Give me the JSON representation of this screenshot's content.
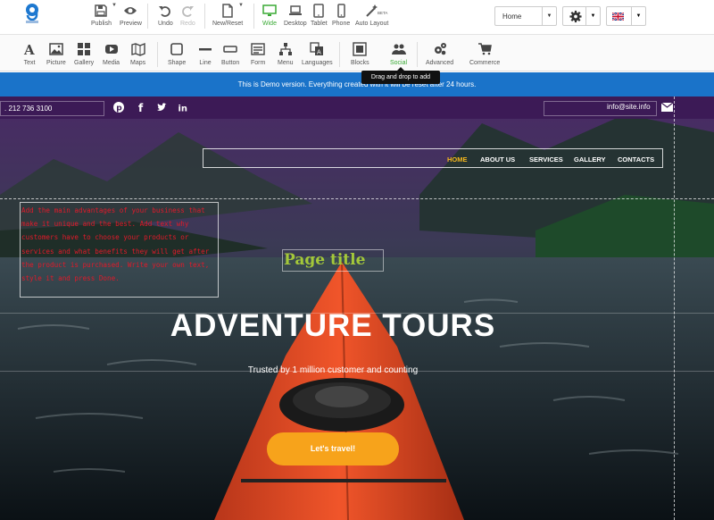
{
  "toolbar": {
    "publish": "Publish",
    "preview": "Preview",
    "undo": "Undo",
    "redo": "Redo",
    "new_reset": "New/Reset",
    "wide": "Wide",
    "desktop": "Desktop",
    "tablet": "Tablet",
    "phone": "Phone",
    "auto_layout": "Auto Layout",
    "beta": "BETA",
    "page_select": "Home"
  },
  "elements": [
    {
      "label": "Text",
      "icon": "text-icon"
    },
    {
      "label": "Picture",
      "icon": "picture-icon"
    },
    {
      "label": "Gallery",
      "icon": "gallery-icon"
    },
    {
      "label": "Media",
      "icon": "media-icon"
    },
    {
      "label": "Maps",
      "icon": "maps-icon"
    },
    {
      "label": "Shape",
      "icon": "shape-icon"
    },
    {
      "label": "Line",
      "icon": "line-icon"
    },
    {
      "label": "Button",
      "icon": "button-icon"
    },
    {
      "label": "Form",
      "icon": "form-icon"
    },
    {
      "label": "Menu",
      "icon": "menu-icon"
    },
    {
      "label": "Languages",
      "icon": "languages-icon"
    },
    {
      "label": "Blocks",
      "icon": "blocks-icon"
    },
    {
      "label": "Social",
      "icon": "social-icon"
    },
    {
      "label": "Advanced",
      "icon": "advanced-icon"
    },
    {
      "label": "Commerce",
      "icon": "commerce-icon"
    }
  ],
  "tooltip": "Drag and drop to add",
  "banner": "This is Demo version. Everything created with it will be reset after 24 hours.",
  "site": {
    "phone": ". 212 736 3100",
    "email": "info@site.info",
    "nav": [
      "HOME",
      "ABOUT US",
      "SERVICES",
      "GALLERY",
      "CONTACTS"
    ],
    "textbox": "Add the main advantages of your business that make it unique and the best. Add text why customers have to choose your products or services and what benefits they will get after the product is purchased. Write your own text, style it and press Done.",
    "page_title": "Page title",
    "hero_title": "ADVENTURE TOURS",
    "hero_subtitle": "Trusted by 1 million customer and counting",
    "cta": "Let's travel!"
  },
  "colors": {
    "banner": "#1a73c9",
    "accent_green": "#3aaa35",
    "nav_active": "#f6b81d",
    "cta": "#f7a31b",
    "textbox_text": "#e01a2a",
    "page_title": "#a4c83a"
  }
}
